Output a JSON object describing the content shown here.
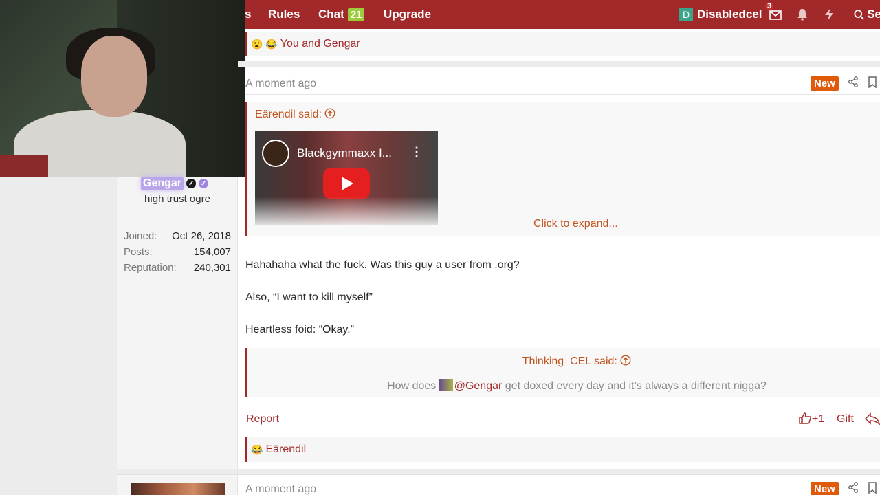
{
  "nav": {
    "cut_item": "s",
    "rules": "Rules",
    "chat": "Chat",
    "chat_count": "21",
    "upgrade": "Upgrade",
    "user_initial": "D",
    "username": "Disabledcel",
    "inbox_count": "3",
    "search_partial": "Se"
  },
  "post1": {
    "reaction_emojis": "😮 😂",
    "reactions_text": "You and Gengar"
  },
  "post2": {
    "timestamp": "A moment ago",
    "new_badge": "New",
    "author": {
      "name": "Gengar",
      "title": "high trust ogre",
      "stats": [
        {
          "label": "Joined:",
          "value": "Oct 26, 2018"
        },
        {
          "label": "Posts:",
          "value": "154,007"
        },
        {
          "label": "Reputation:",
          "value": "240,301"
        }
      ]
    },
    "quote": {
      "attribution": "Eärendil said:",
      "video_title": "Blackgymmaxx I...",
      "expand": "Click to expand..."
    },
    "body": [
      "Hahahaha what the fuck. Was this guy a user from .org?",
      "Also, “I want to kill myself”",
      "Heartless foid: “Okay.”"
    ],
    "quote2": {
      "attribution": "Thinking_CEL said:",
      "text_before": "How does",
      "mention": "@Gengar",
      "text_after": "get doxed every day and it’s always a different nigga?"
    },
    "actions": {
      "report": "Report",
      "plus_one": "+1",
      "gift": "Gift"
    },
    "reaction_emoji": "😂",
    "reactions_text": "Eärendil"
  },
  "post3": {
    "timestamp": "A moment ago",
    "new_badge": "New"
  },
  "colors": {
    "accent": "#a12929",
    "link_orange": "#c0541e",
    "new_badge": "#e05a0c",
    "chat_badge": "#9ccc3c"
  }
}
